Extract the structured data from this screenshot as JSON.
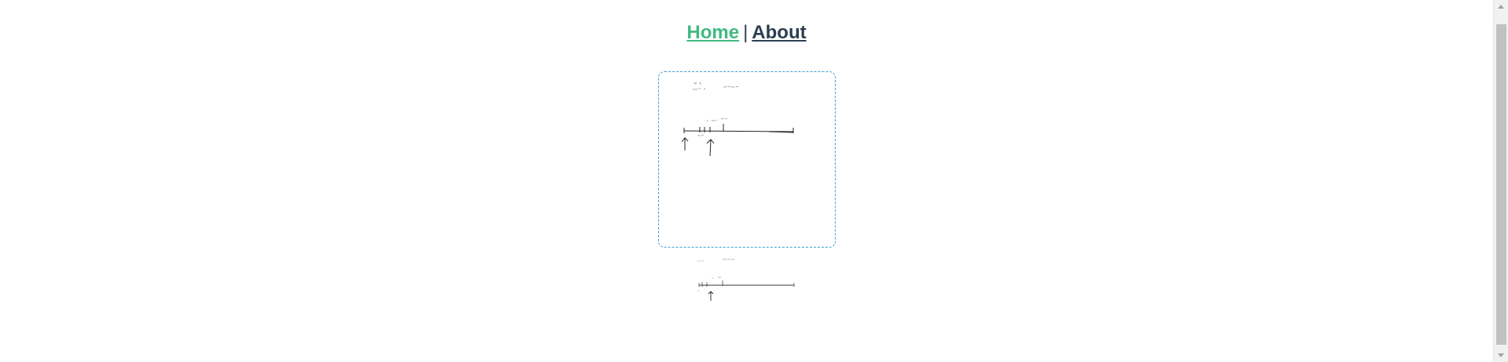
{
  "nav": {
    "home_label": "Home",
    "separator": "|",
    "about_label": "About"
  },
  "colors": {
    "home_link": "#42b983",
    "about_link": "#2c3e50",
    "canvas_border": "#3aa0d8"
  },
  "icons": {
    "scroll_up": "chevron-up-icon",
    "scroll_down": "chevron-down-icon"
  }
}
